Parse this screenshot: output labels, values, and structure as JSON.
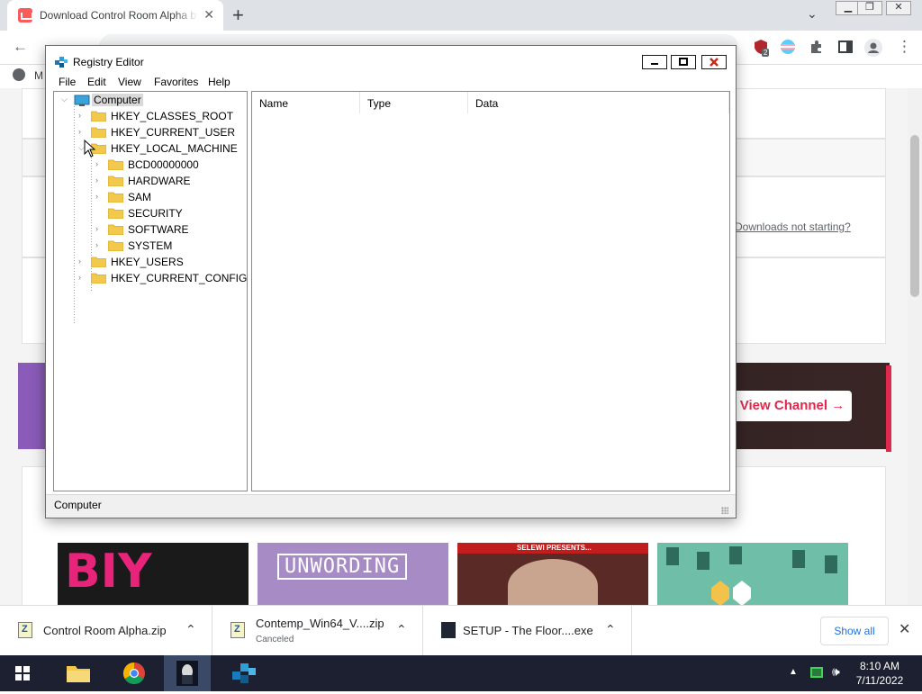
{
  "browser": {
    "tab_title": "Download Control Room Alpha by",
    "tab_close": "✕",
    "newtab": "+",
    "tab_search": "⌄",
    "window_controls": [
      "▁",
      "❐",
      "✕"
    ],
    "url": "...",
    "bookmark_label": "M",
    "extension_badge": "2"
  },
  "page": {
    "downloads_link": "Downloads not starting?",
    "view_channel": "View Channel →",
    "thumbs": [
      "BIY",
      "UNWORDING",
      "SELEWI PRESENTS..."
    ]
  },
  "registry": {
    "title": "Registry Editor",
    "menu": [
      "File",
      "Edit",
      "View",
      "Favorites",
      "Help"
    ],
    "root": "Computer",
    "hives": [
      "HKEY_CLASSES_ROOT",
      "HKEY_CURRENT_USER",
      "HKEY_LOCAL_MACHINE",
      "HKEY_USERS",
      "HKEY_CURRENT_CONFIG"
    ],
    "local_machine_children": [
      "BCD00000000",
      "HARDWARE",
      "SAM",
      "SECURITY",
      "SOFTWARE",
      "SYSTEM"
    ],
    "columns": [
      "Name",
      "Type",
      "Data"
    ],
    "status": "Computer"
  },
  "downloads": {
    "items": [
      {
        "name": "Control Room Alpha.zip",
        "sub": ""
      },
      {
        "name": "Contemp_Win64_V....zip",
        "sub": "Canceled"
      },
      {
        "name": "SETUP - The Floor....exe",
        "sub": ""
      }
    ],
    "show_all": "Show all",
    "close": "✕"
  },
  "taskbar": {
    "time": "8:10 AM",
    "date": "7/11/2022"
  },
  "colors": {
    "accent_red": "#e0284d",
    "taskbar": "#1c2030",
    "folder": "#f2c94c"
  }
}
